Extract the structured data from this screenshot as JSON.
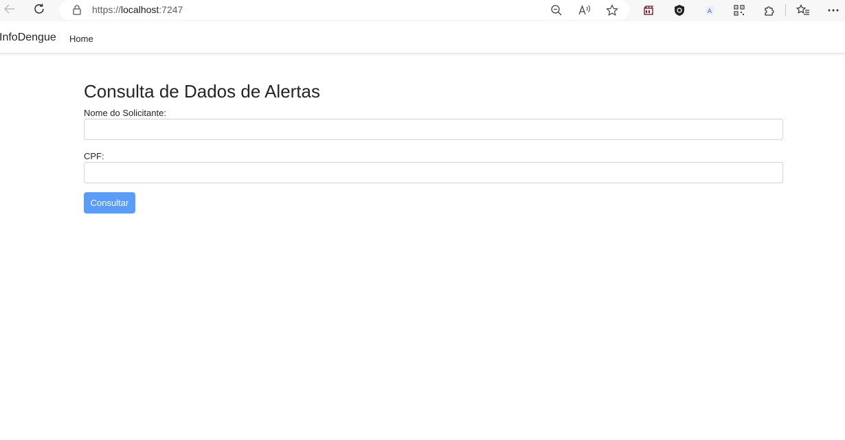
{
  "browser": {
    "url_scheme": "https://",
    "url_host": "localhost",
    "url_port": ":7247",
    "icons": [
      "back-arrow-icon",
      "refresh-icon",
      "lock-icon",
      "zoom-out-icon",
      "read-aloud-icon",
      "favorite-star-icon",
      "extension-clapper-icon",
      "extension-shield-icon",
      "extension-translate-icon",
      "qr-code-icon",
      "extensions-puzzle-icon",
      "favorites-list-icon",
      "more-icon"
    ]
  },
  "navbar": {
    "brand": "InfoDengue",
    "home_link": "Home"
  },
  "form": {
    "title": "Consulta de Dados de Alertas",
    "name_label": "Nome do Solicitante:",
    "name_value": "",
    "cpf_label": "CPF:",
    "cpf_value": "",
    "submit_label": "Consultar"
  },
  "colors": {
    "button_bg": "#5a9cf8",
    "button_text": "#ffffff",
    "text": "#212529",
    "input_border": "#ced4da"
  }
}
